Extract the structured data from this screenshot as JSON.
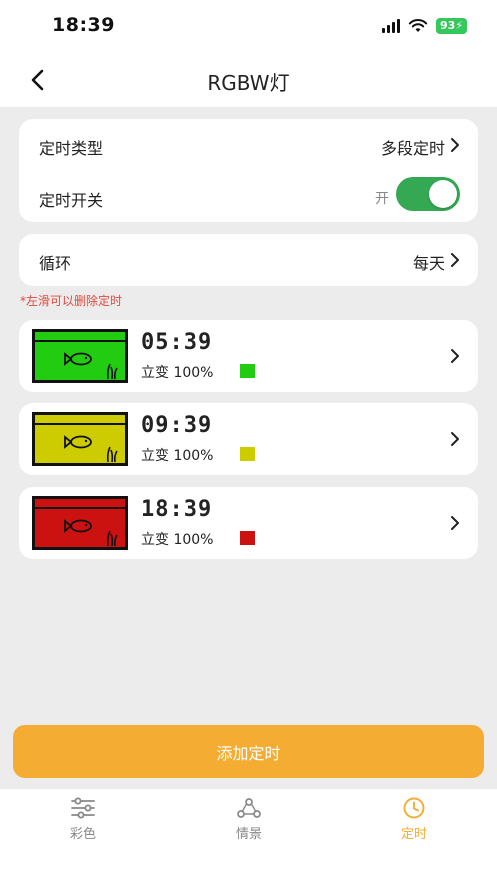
{
  "status_bar": {
    "time": "18:39",
    "battery": "93"
  },
  "nav": {
    "title": "RGBW灯"
  },
  "settings": {
    "type_label": "定时类型",
    "type_value": "多段定时",
    "switch_label": "定时开关",
    "switch_state_text": "开",
    "switch_on": true,
    "loop_label": "循环",
    "loop_value": "每天"
  },
  "hint": "*左滑可以删除定时",
  "timers": [
    {
      "time": "05:39",
      "mode": "立变 100%",
      "color": "#22cc11"
    },
    {
      "time": "09:39",
      "mode": "立变 100%",
      "color": "#cccc00"
    },
    {
      "time": "18:39",
      "mode": "立变 100%",
      "color": "#cc1111"
    }
  ],
  "add_button": "添加定时",
  "tabs": [
    {
      "label": "彩色",
      "icon": "sliders-icon",
      "active": false
    },
    {
      "label": "情景",
      "icon": "scene-icon",
      "active": false
    },
    {
      "label": "定时",
      "icon": "clock-icon",
      "active": true
    }
  ],
  "colors": {
    "accent": "#f5ac33",
    "toggle_on": "#34a853",
    "hint": "#e04a3f"
  }
}
